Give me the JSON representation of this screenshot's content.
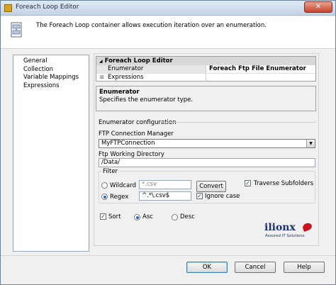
{
  "window": {
    "title": "Foreach Loop Editor",
    "close_label": "✕"
  },
  "header": {
    "text": "The Foreach Loop container allows execution iteration over an enumeration."
  },
  "nav": {
    "items": [
      "General",
      "Collection",
      "Variable Mappings",
      "Expressions"
    ]
  },
  "grid": {
    "category": "Foreach Loop Editor",
    "rows": [
      {
        "name": "Enumerator",
        "value": "Foreach Ftp File Enumerator"
      },
      {
        "name": "Expressions",
        "value": ""
      }
    ]
  },
  "description": {
    "title": "Enumerator",
    "text": "Specifies the enumerator type."
  },
  "config": {
    "section_label": "Enumerator configuration",
    "connection_label": "FTP Connection Manager",
    "connection_value": "MyFTPConnection",
    "directory_label": "Ftp Working Directory",
    "directory_value": "/Data/",
    "filter_label": "Filter",
    "wildcard_label": "Wildcard",
    "wildcard_placeholder": "*.csv",
    "convert_label": "Convert",
    "traverse_label": "Traverse Subfolders",
    "regex_label": "Regex",
    "regex_value": "^.*\\.csv$",
    "ignore_case_label": "Ignore case",
    "sort_label": "Sort",
    "asc_label": "Asc",
    "desc_label": "Desc",
    "check_mark": "✓"
  },
  "logo": {
    "word": "ilionx",
    "tagline": "Assured IT Solutions"
  },
  "buttons": {
    "ok": "OK",
    "cancel": "Cancel",
    "help": "Help"
  }
}
